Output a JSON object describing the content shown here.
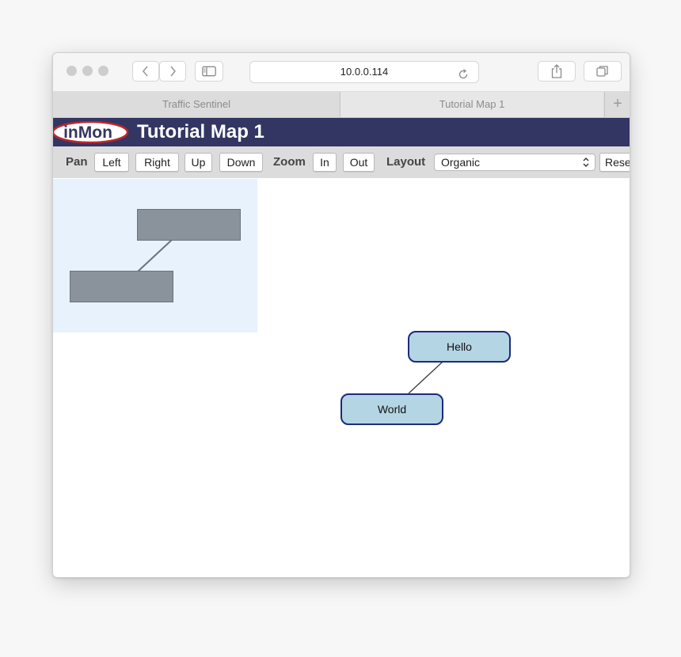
{
  "browser": {
    "address": "10.0.0.114",
    "tabs": [
      {
        "label": "Traffic Sentinel",
        "active": false
      },
      {
        "label": "Tutorial Map 1",
        "active": true
      }
    ],
    "new_tab_label": "+",
    "icons": [
      "chevron-left-icon",
      "chevron-right-icon",
      "sidebar-icon",
      "reload-icon",
      "share-icon",
      "tabs-overview-icon"
    ]
  },
  "app": {
    "logo_text": "inMon",
    "title": "Tutorial Map 1",
    "header_color": "#333663"
  },
  "controls": {
    "pan_label": "Pan",
    "pan_left": "Left",
    "pan_right": "Right",
    "pan_up": "Up",
    "pan_down": "Down",
    "zoom_label": "Zoom",
    "zoom_in": "In",
    "zoom_out": "Out",
    "layout_label": "Layout",
    "layout_selected": "Organic",
    "reset": "Reset"
  },
  "map": {
    "nodes": [
      {
        "id": "hello",
        "label": "Hello"
      },
      {
        "id": "world",
        "label": "World"
      }
    ],
    "links": [
      [
        "hello",
        "world"
      ]
    ],
    "node_fill": "#b4d5e4",
    "node_border": "#1f2a7a",
    "overview_bg": "#e7f2fd"
  }
}
